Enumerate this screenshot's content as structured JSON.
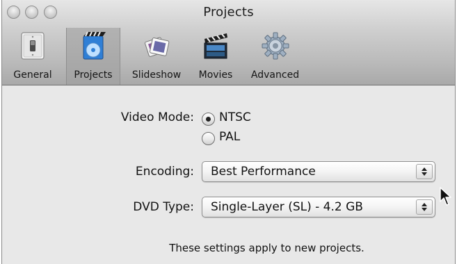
{
  "window": {
    "title": "Projects"
  },
  "toolbar": {
    "items": [
      {
        "label": "General",
        "icon": "light-switch-icon",
        "selected": false
      },
      {
        "label": "Projects",
        "icon": "dvd-project-icon",
        "selected": true
      },
      {
        "label": "Slideshow",
        "icon": "slides-icon",
        "selected": false
      },
      {
        "label": "Movies",
        "icon": "clapperboard-icon",
        "selected": false
      },
      {
        "label": "Advanced",
        "icon": "gear-icon",
        "selected": false
      }
    ]
  },
  "form": {
    "video_mode": {
      "label": "Video Mode:",
      "options": [
        {
          "label": "NTSC",
          "selected": true
        },
        {
          "label": "PAL",
          "selected": false
        }
      ]
    },
    "encoding": {
      "label": "Encoding:",
      "value": "Best Performance"
    },
    "dvd_type": {
      "label": "DVD Type:",
      "value": "Single-Layer (SL) - 4.2 GB"
    },
    "note": "These settings apply to new projects."
  }
}
